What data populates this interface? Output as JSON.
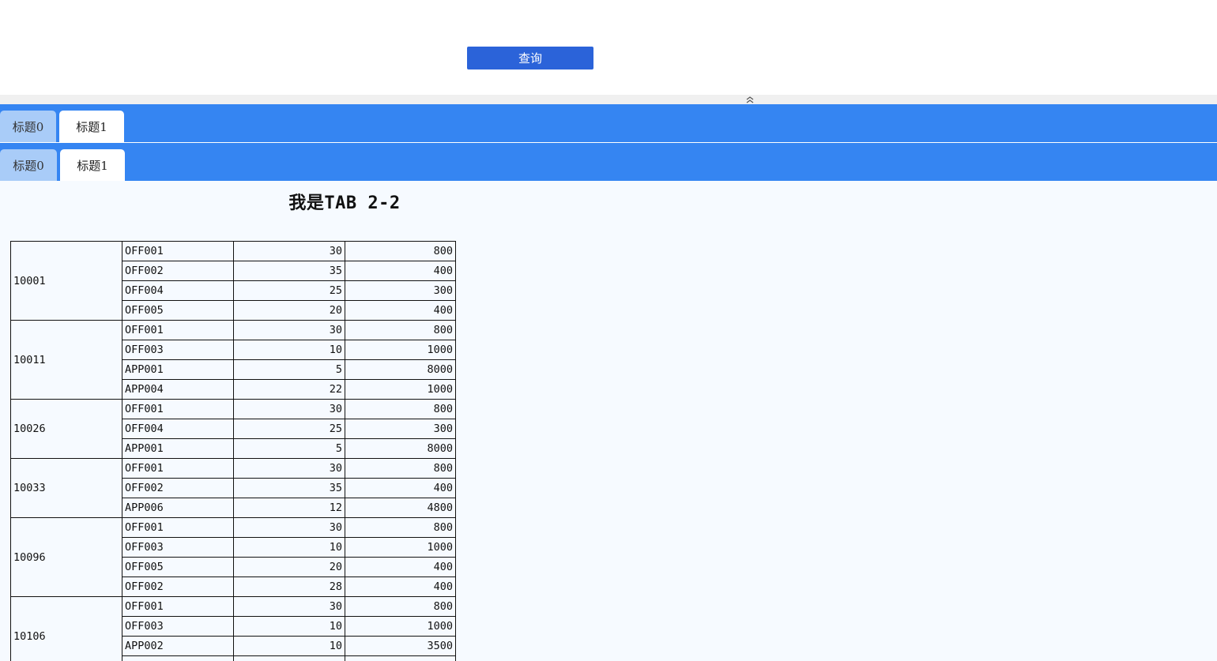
{
  "query": {
    "button_label": "查询"
  },
  "tabs_outer": [
    {
      "label": "标题0"
    },
    {
      "label": "标题1"
    }
  ],
  "tabs_inner": [
    {
      "label": "标题0"
    },
    {
      "label": "标题1"
    }
  ],
  "content": {
    "title": "我是TAB 2-2"
  },
  "table": {
    "groups": [
      {
        "id": "10001",
        "rows": [
          [
            "OFF001",
            "30",
            "800"
          ],
          [
            "OFF002",
            "35",
            "400"
          ],
          [
            "OFF004",
            "25",
            "300"
          ],
          [
            "OFF005",
            "20",
            "400"
          ]
        ]
      },
      {
        "id": "10011",
        "rows": [
          [
            "OFF001",
            "30",
            "800"
          ],
          [
            "OFF003",
            "10",
            "1000"
          ],
          [
            "APP001",
            "5",
            "8000"
          ],
          [
            "APP004",
            "22",
            "1000"
          ]
        ]
      },
      {
        "id": "10026",
        "rows": [
          [
            "OFF001",
            "30",
            "800"
          ],
          [
            "OFF004",
            "25",
            "300"
          ],
          [
            "APP001",
            "5",
            "8000"
          ]
        ]
      },
      {
        "id": "10033",
        "rows": [
          [
            "OFF001",
            "30",
            "800"
          ],
          [
            "OFF002",
            "35",
            "400"
          ],
          [
            "APP006",
            "12",
            "4800"
          ]
        ]
      },
      {
        "id": "10096",
        "rows": [
          [
            "OFF001",
            "30",
            "800"
          ],
          [
            "OFF003",
            "10",
            "1000"
          ],
          [
            "OFF005",
            "20",
            "400"
          ],
          [
            "OFF002",
            "28",
            "400"
          ]
        ]
      },
      {
        "id": "10106",
        "rows": [
          [
            "OFF001",
            "30",
            "800"
          ],
          [
            "OFF003",
            "10",
            "1000"
          ],
          [
            "APP002",
            "10",
            "3500"
          ],
          [
            "",
            "",
            ""
          ]
        ]
      }
    ]
  },
  "colors": {
    "tabbar": "#3585f2",
    "button": "#2b63d9",
    "inactive_tab": "#a9ccf8",
    "content_bg": "#f6faff"
  },
  "icons": {
    "collapse": "double-chevron-up-icon"
  }
}
